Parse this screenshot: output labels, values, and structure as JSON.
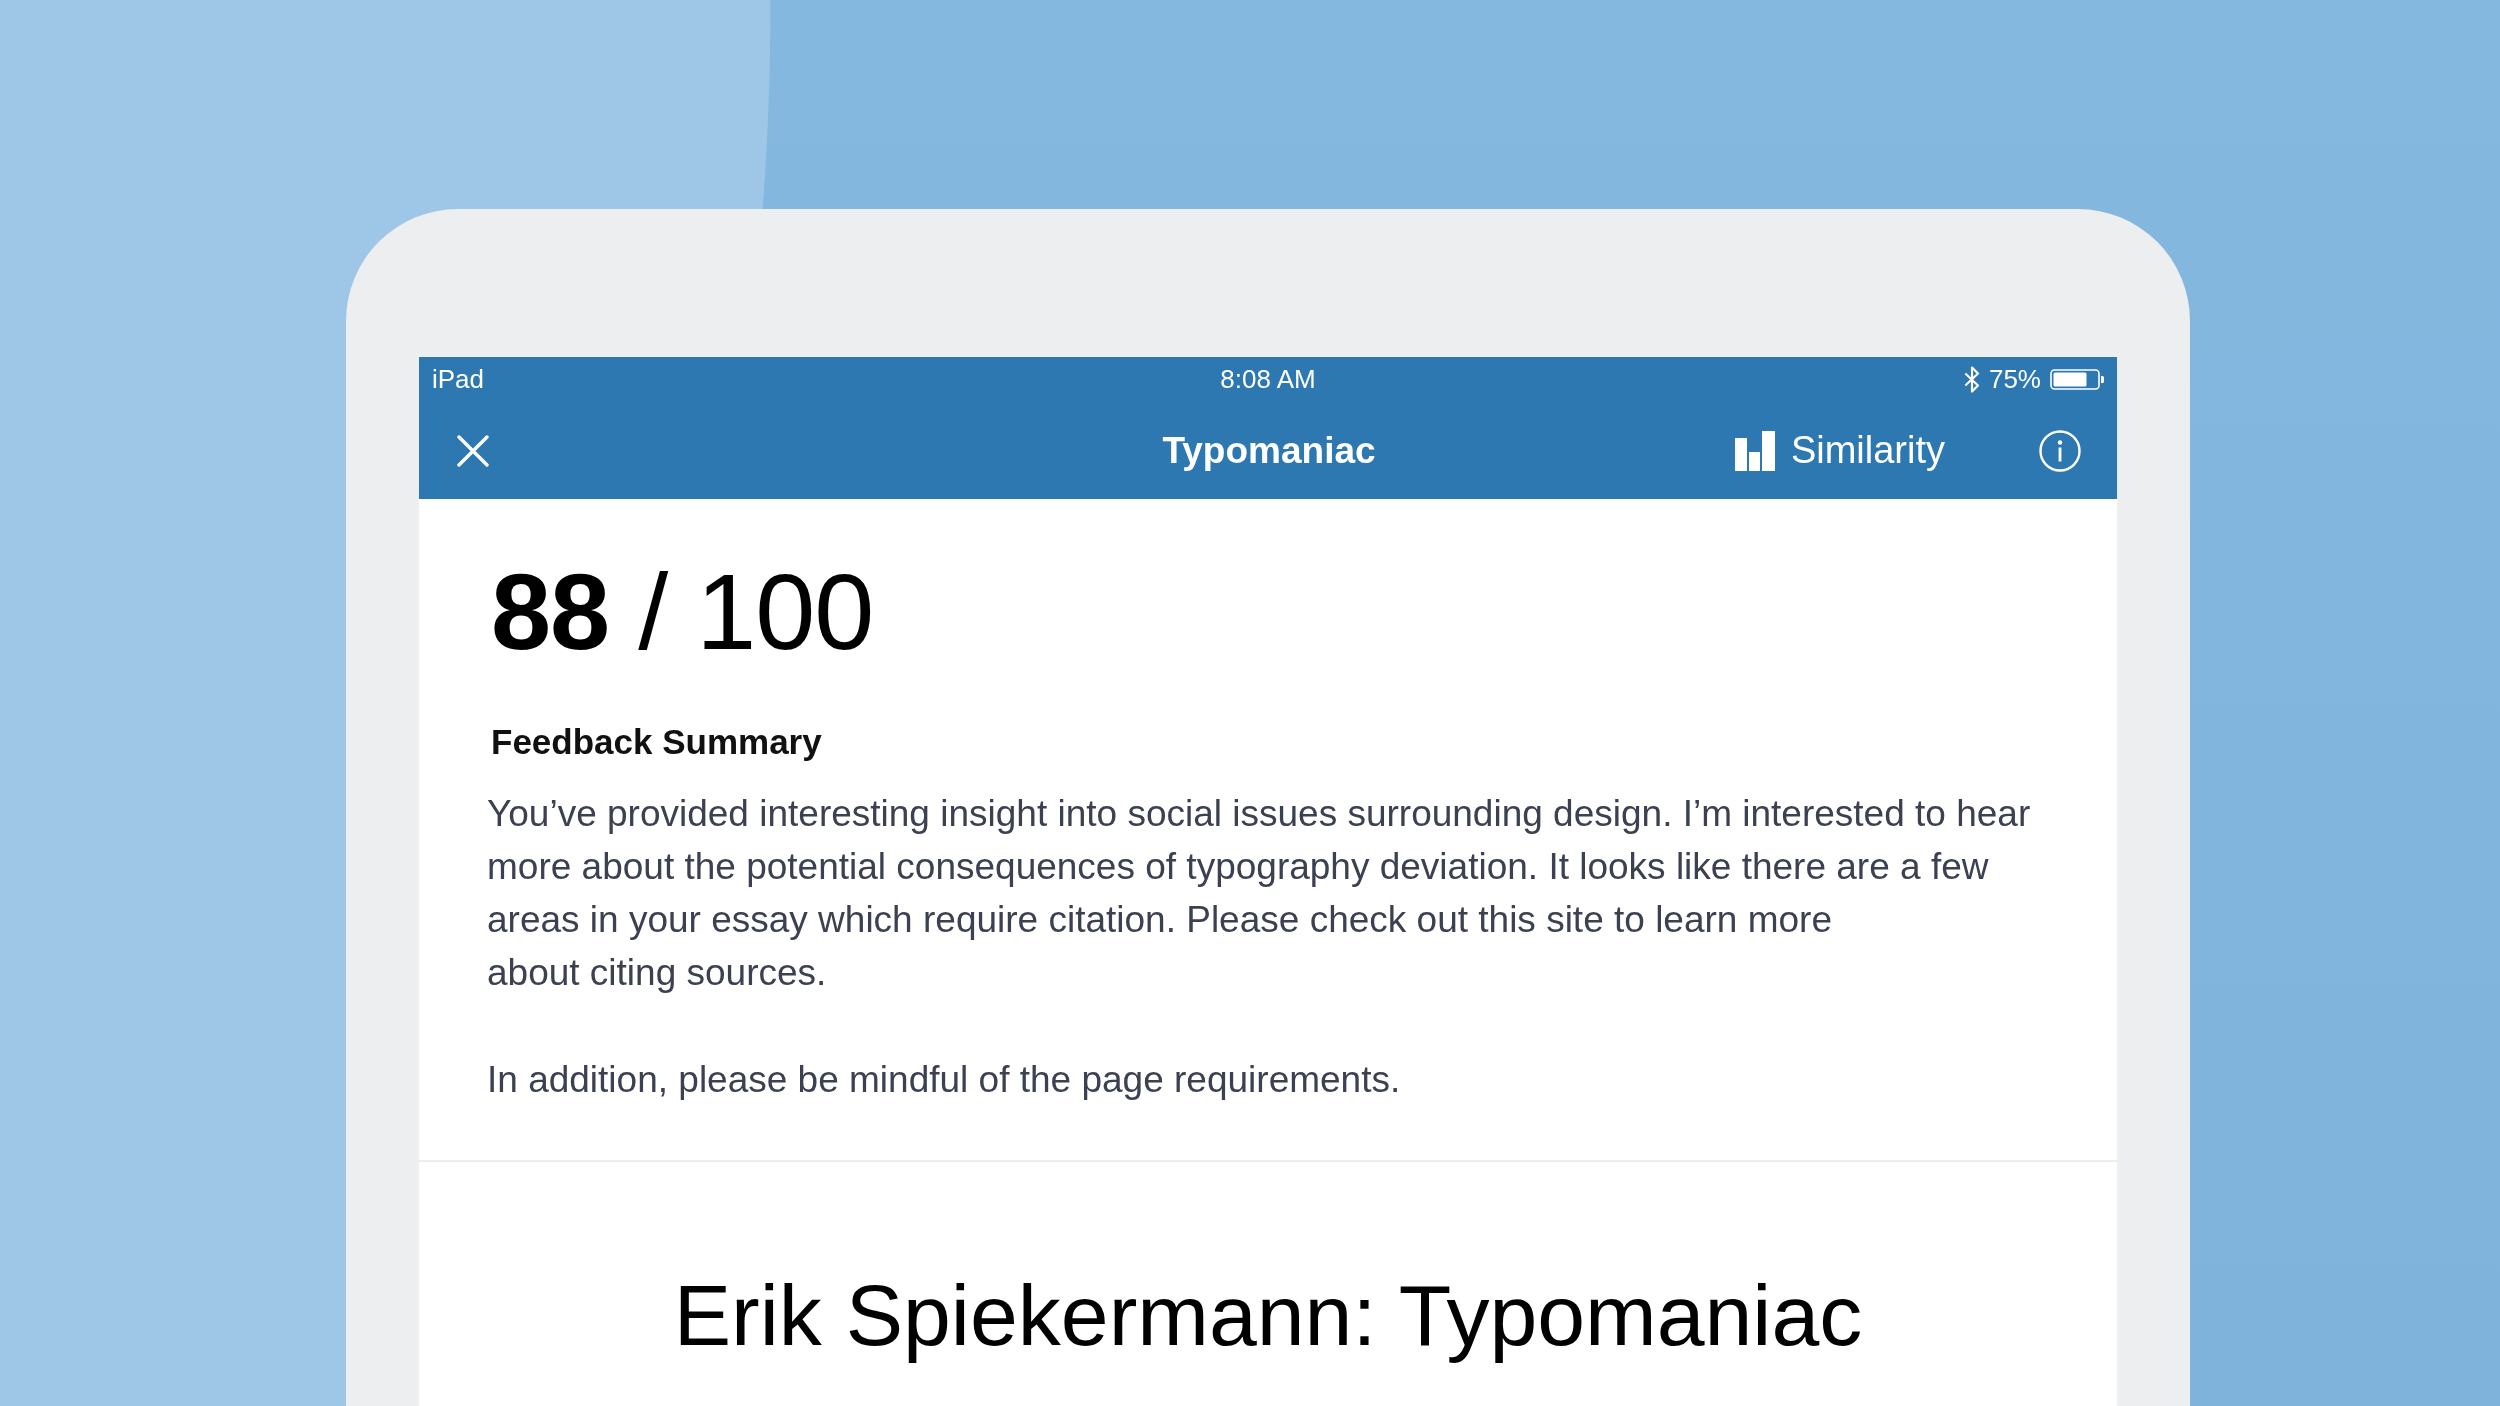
{
  "status_bar": {
    "device": "iPad",
    "time": "8:08 AM",
    "battery": "75%"
  },
  "nav_bar": {
    "title": "Typomaniac",
    "similarity_button": "Similarity"
  },
  "score": "**88** / 100",
  "feedback": {
    "heading": "Feedback Summary",
    "paragraphs": [
      {
        "lines": [
          "You’ve provided interesting insight into social issues surrounding design. I’m interested to hear",
          "more about the potential consequences of typography deviation. It looks like there are a few",
          "areas in your essay which require citation. Please check out this site to learn more",
          "about citing sources."
        ]
      },
      {
        "lines": [
          "In addition, please be mindful of the page requirements."
        ]
      }
    ]
  },
  "document": {
    "title": "Erik Spiekermann: Typomaniac"
  }
}
